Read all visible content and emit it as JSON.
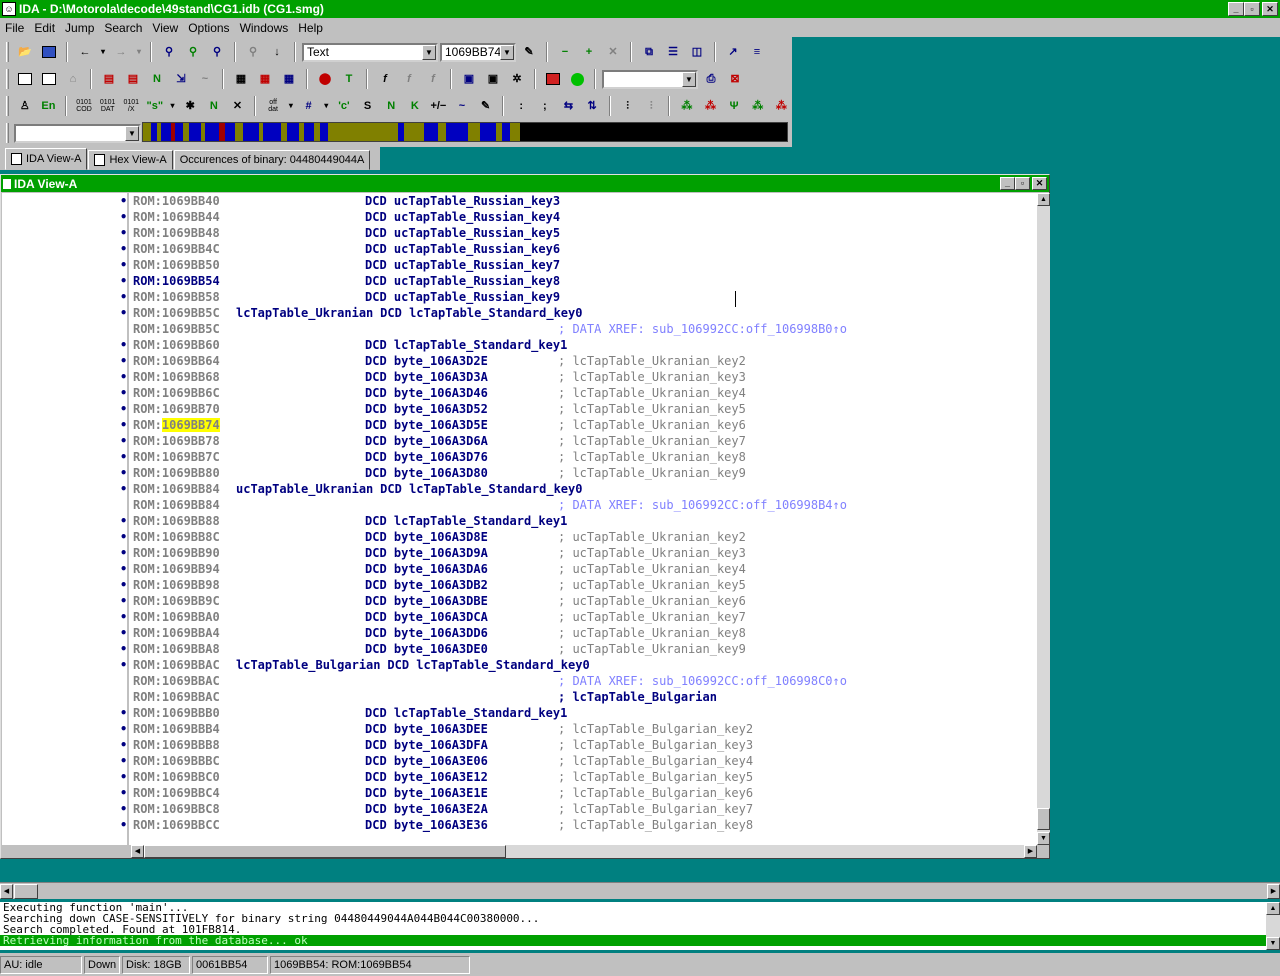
{
  "app": {
    "title": "IDA - D:\\Motorola\\decode\\49stand\\CG1.idb (CG1.smg)",
    "icon": "ida-app-icon"
  },
  "window_controls": {
    "minimize": "_",
    "maximize": "▫",
    "close": "✕"
  },
  "menu": [
    "File",
    "Edit",
    "Jump",
    "Search",
    "View",
    "Options",
    "Windows",
    "Help"
  ],
  "toolbar": {
    "mode_combo": "Text",
    "address_combo": "1069BB74",
    "row2_combo": "",
    "row4_combo": ""
  },
  "tabs": [
    {
      "label": "IDA View-A",
      "active": true
    },
    {
      "label": "Hex View-A",
      "active": false
    },
    {
      "label": "Occurences of binary: 04480449044A",
      "active": false
    }
  ],
  "ida_view": {
    "title": "IDA View-A",
    "lines": [
      {
        "bullet": "•",
        "addr": "ROM:1069BB40",
        "label": "",
        "instr": "DCD ucTapTable_Russian_key3",
        "comment": ""
      },
      {
        "bullet": "•",
        "addr": "ROM:1069BB44",
        "label": "",
        "instr": "DCD ucTapTable_Russian_key4",
        "comment": ""
      },
      {
        "bullet": "•",
        "addr": "ROM:1069BB48",
        "label": "",
        "instr": "DCD ucTapTable_Russian_key5",
        "comment": ""
      },
      {
        "bullet": "•",
        "addr": "ROM:1069BB4C",
        "label": "",
        "instr": "DCD ucTapTable_Russian_key6",
        "comment": ""
      },
      {
        "bullet": "•",
        "addr": "ROM:1069BB50",
        "label": "",
        "instr": "DCD ucTapTable_Russian_key7",
        "comment": ""
      },
      {
        "bullet": "•",
        "addr": "ROM:1069BB54",
        "label": "",
        "instr": "DCD ucTapTable_Russian_key8",
        "comment": "",
        "current": true
      },
      {
        "bullet": "•",
        "addr": "ROM:1069BB58",
        "label": "",
        "instr": "DCD ucTapTable_Russian_key9",
        "comment": ""
      },
      {
        "bullet": "•",
        "addr": "ROM:1069BB5C",
        "label": "lcTapTable_Ukranian",
        "instr": "DCD lcTapTable_Standard_key0",
        "comment": ""
      },
      {
        "bullet": "",
        "addr": "ROM:1069BB5C",
        "label": "",
        "instr": "",
        "comment": "; DATA XREF: sub_106992CC:off_106998B0↑o",
        "xref": true
      },
      {
        "bullet": "•",
        "addr": "ROM:1069BB60",
        "label": "",
        "instr": "DCD lcTapTable_Standard_key1",
        "comment": ""
      },
      {
        "bullet": "•",
        "addr": "ROM:1069BB64",
        "label": "",
        "instr": "DCD byte_106A3D2E",
        "comment": "; lcTapTable_Ukranian_key2"
      },
      {
        "bullet": "•",
        "addr": "ROM:1069BB68",
        "label": "",
        "instr": "DCD byte_106A3D3A",
        "comment": "; lcTapTable_Ukranian_key3"
      },
      {
        "bullet": "•",
        "addr": "ROM:1069BB6C",
        "label": "",
        "instr": "DCD byte_106A3D46",
        "comment": "; lcTapTable_Ukranian_key4"
      },
      {
        "bullet": "•",
        "addr": "ROM:1069BB70",
        "label": "",
        "instr": "DCD byte_106A3D52",
        "comment": "; lcTapTable_Ukranian_key5"
      },
      {
        "bullet": "•",
        "addr": "ROM:1069BB74",
        "label": "",
        "instr": "DCD byte_106A3D5E",
        "comment": "; lcTapTable_Ukranian_key6",
        "highlight": true
      },
      {
        "bullet": "•",
        "addr": "ROM:1069BB78",
        "label": "",
        "instr": "DCD byte_106A3D6A",
        "comment": "; lcTapTable_Ukranian_key7"
      },
      {
        "bullet": "•",
        "addr": "ROM:1069BB7C",
        "label": "",
        "instr": "DCD byte_106A3D76",
        "comment": "; lcTapTable_Ukranian_key8"
      },
      {
        "bullet": "•",
        "addr": "ROM:1069BB80",
        "label": "",
        "instr": "DCD byte_106A3D80",
        "comment": "; lcTapTable_Ukranian_key9"
      },
      {
        "bullet": "•",
        "addr": "ROM:1069BB84",
        "label": "ucTapTable_Ukranian",
        "instr": "DCD lcTapTable_Standard_key0",
        "comment": ""
      },
      {
        "bullet": "",
        "addr": "ROM:1069BB84",
        "label": "",
        "instr": "",
        "comment": "; DATA XREF: sub_106992CC:off_106998B4↑o",
        "xref": true
      },
      {
        "bullet": "•",
        "addr": "ROM:1069BB88",
        "label": "",
        "instr": "DCD lcTapTable_Standard_key1",
        "comment": ""
      },
      {
        "bullet": "•",
        "addr": "ROM:1069BB8C",
        "label": "",
        "instr": "DCD byte_106A3D8E",
        "comment": "; ucTapTable_Ukranian_key2"
      },
      {
        "bullet": "•",
        "addr": "ROM:1069BB90",
        "label": "",
        "instr": "DCD byte_106A3D9A",
        "comment": "; ucTapTable_Ukranian_key3"
      },
      {
        "bullet": "•",
        "addr": "ROM:1069BB94",
        "label": "",
        "instr": "DCD byte_106A3DA6",
        "comment": "; ucTapTable_Ukranian_key4"
      },
      {
        "bullet": "•",
        "addr": "ROM:1069BB98",
        "label": "",
        "instr": "DCD byte_106A3DB2",
        "comment": "; ucTapTable_Ukranian_key5"
      },
      {
        "bullet": "•",
        "addr": "ROM:1069BB9C",
        "label": "",
        "instr": "DCD byte_106A3DBE",
        "comment": "; ucTapTable_Ukranian_key6"
      },
      {
        "bullet": "•",
        "addr": "ROM:1069BBA0",
        "label": "",
        "instr": "DCD byte_106A3DCA",
        "comment": "; ucTapTable_Ukranian_key7"
      },
      {
        "bullet": "•",
        "addr": "ROM:1069BBA4",
        "label": "",
        "instr": "DCD byte_106A3DD6",
        "comment": "; ucTapTable_Ukranian_key8"
      },
      {
        "bullet": "•",
        "addr": "ROM:1069BBA8",
        "label": "",
        "instr": "DCD byte_106A3DE0",
        "comment": "; ucTapTable_Ukranian_key9"
      },
      {
        "bullet": "•",
        "addr": "ROM:1069BBAC",
        "label": "lcTapTable_Bulgarian",
        "instr": "DCD lcTapTable_Standard_key0",
        "comment": ""
      },
      {
        "bullet": "",
        "addr": "ROM:1069BBAC",
        "label": "",
        "instr": "",
        "comment": "; DATA XREF: sub_106992CC:off_106998C0↑o",
        "xref": true
      },
      {
        "bullet": "",
        "addr": "ROM:1069BBAC",
        "label": "",
        "instr": "",
        "comment": "; lcTapTable_Bulgarian",
        "bold_comment": true
      },
      {
        "bullet": "•",
        "addr": "ROM:1069BBB0",
        "label": "",
        "instr": "DCD lcTapTable_Standard_key1",
        "comment": ""
      },
      {
        "bullet": "•",
        "addr": "ROM:1069BBB4",
        "label": "",
        "instr": "DCD byte_106A3DEE",
        "comment": "; lcTapTable_Bulgarian_key2"
      },
      {
        "bullet": "•",
        "addr": "ROM:1069BBB8",
        "label": "",
        "instr": "DCD byte_106A3DFA",
        "comment": "; lcTapTable_Bulgarian_key3"
      },
      {
        "bullet": "•",
        "addr": "ROM:1069BBBC",
        "label": "",
        "instr": "DCD byte_106A3E06",
        "comment": "; lcTapTable_Bulgarian_key4"
      },
      {
        "bullet": "•",
        "addr": "ROM:1069BBC0",
        "label": "",
        "instr": "DCD byte_106A3E12",
        "comment": "; lcTapTable_Bulgarian_key5"
      },
      {
        "bullet": "•",
        "addr": "ROM:1069BBC4",
        "label": "",
        "instr": "DCD byte_106A3E1E",
        "comment": "; lcTapTable_Bulgarian_key6"
      },
      {
        "bullet": "•",
        "addr": "ROM:1069BBC8",
        "label": "",
        "instr": "DCD byte_106A3E2A",
        "comment": "; lcTapTable_Bulgarian_key7"
      },
      {
        "bullet": "•",
        "addr": "ROM:1069BBCC",
        "label": "",
        "instr": "DCD byte_106A3E36",
        "comment": "; lcTapTable_Bulgarian_key8"
      }
    ]
  },
  "output": [
    "Executing function 'main'...",
    "Searching down CASE-SENSITIVELY for binary string 04480449044A044B044C00380000...",
    "Search completed. Found at 101FB814.",
    "Retrieving information from the database... ok"
  ],
  "status": {
    "au": "AU:  idle",
    "direction": "Down",
    "disk": "Disk: 18GB",
    "offset": "0061BB54",
    "location": "1069BB54: ROM:1069BB54"
  },
  "colors": {
    "title_bar": "#00a000",
    "desktop": "#008080",
    "code_text": "#000080",
    "address_text": "#808080",
    "xref_text": "#8080ff",
    "highlight": "#ffff00"
  }
}
